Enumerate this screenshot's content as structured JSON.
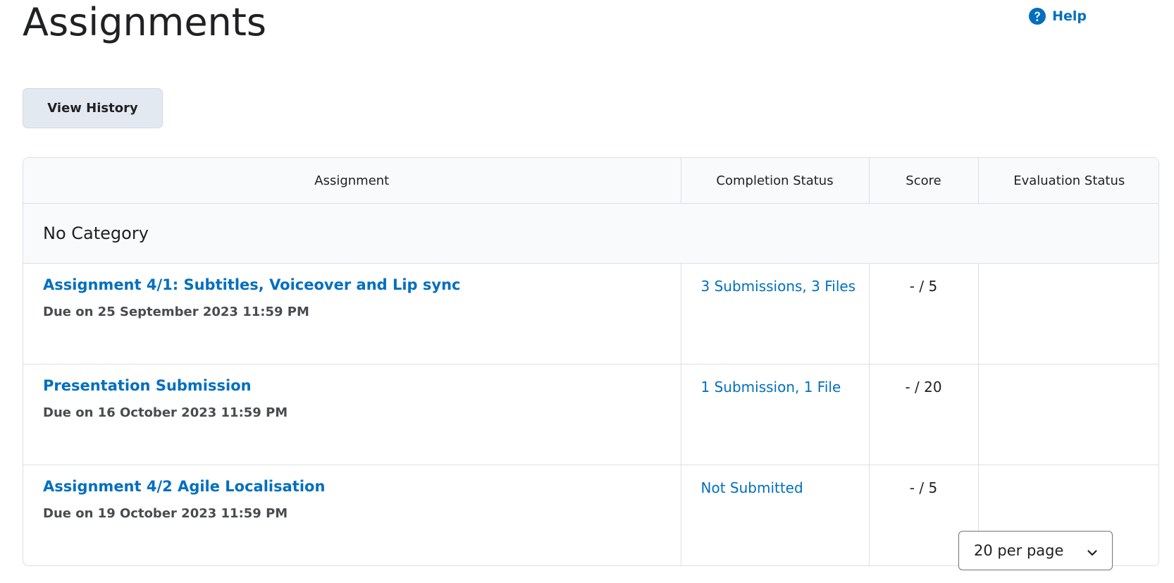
{
  "page": {
    "title": "Assignments"
  },
  "header": {
    "help_label": "Help",
    "help_icon": "question-circle-icon",
    "accent_color": "#006fbf"
  },
  "toolbar": {
    "view_history_label": "View History"
  },
  "table": {
    "columns": [
      "Assignment",
      "Completion Status",
      "Score",
      "Evaluation Status"
    ],
    "category": "No Category",
    "rows": [
      {
        "title": "Assignment 4/1: Subtitles, Voiceover and Lip sync",
        "due": "Due on 25 September 2023 11:59 PM",
        "completion": "3 Submissions, 3 Files",
        "score": "- / 5",
        "evaluation": ""
      },
      {
        "title": "Presentation Submission",
        "due": "Due on 16 October 2023 11:59 PM",
        "completion": "1 Submission, 1 File",
        "score": "- / 20",
        "evaluation": ""
      },
      {
        "title": "Assignment 4/2 Agile Localisation",
        "due": "Due on 19 October 2023 11:59 PM",
        "completion": "Not Submitted",
        "score": "- / 5",
        "evaluation": ""
      }
    ]
  },
  "pagination": {
    "per_page_label": "20 per page",
    "chevron_icon": "chevron-down-icon"
  }
}
